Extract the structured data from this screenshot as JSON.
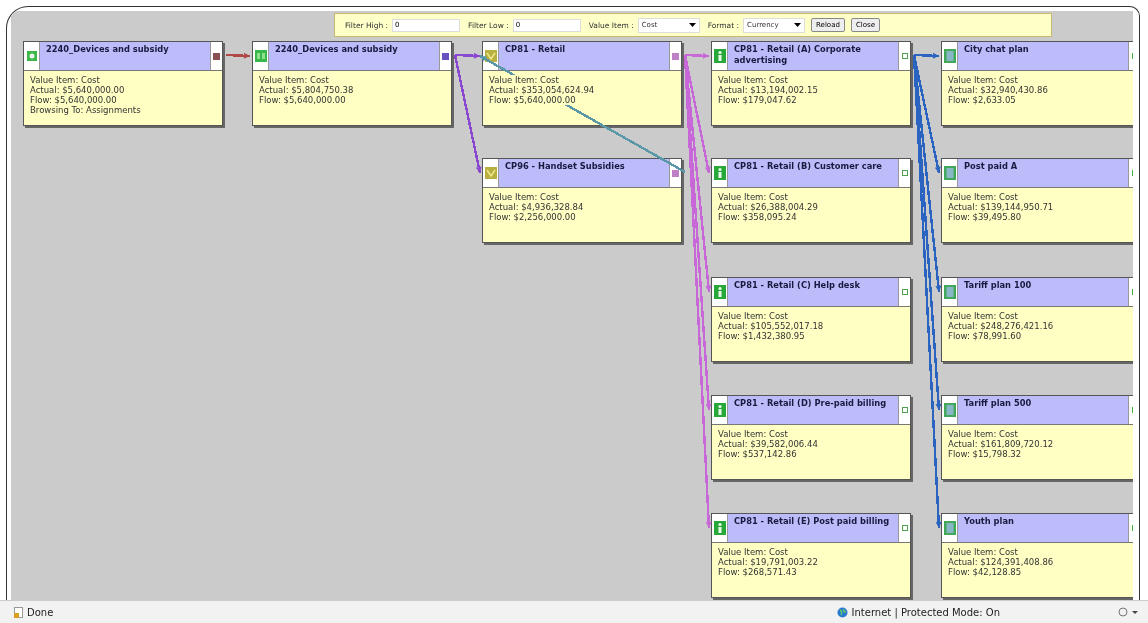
{
  "toolbar": {
    "filter_high": {
      "label": "Filter High :",
      "value": "0"
    },
    "filter_low": {
      "label": "Filter Low :",
      "value": "0"
    },
    "value_item": {
      "label": "Value Item :",
      "value": "Cost"
    },
    "format": {
      "label": "Format :",
      "value": "Currency"
    },
    "buttons": [
      "Reload",
      "Close"
    ]
  },
  "nodes": [
    {
      "kind": "source",
      "title": "2240_Devices and subsidy",
      "lines": [
        "Value Item: Cost",
        "Actual: $5,640,000.00",
        "Flow: $5,640,000.00",
        "Browsing To: Assignments"
      ]
    },
    {
      "kind": "resource",
      "title": "2240_Devices and subsidy",
      "lines": [
        "Value Item: Cost",
        "Actual: $5,804,750.38",
        "Flow: $5,640,000.00"
      ]
    },
    {
      "kind": "center",
      "title": "CP81 - Retail",
      "lines": [
        "Value Item: Cost",
        "Actual: $353,054,624.94",
        "Flow: $5,640,000.00"
      ]
    },
    {
      "kind": "center",
      "title": "CP96 - Handset Subsidies",
      "lines": [
        "Value Item: Cost",
        "Actual: $4,936,328.84",
        "Flow: $2,256,000.00"
      ]
    },
    {
      "kind": "activity",
      "title": "CP81 - Retail (A) Corporate advertising",
      "lines": [
        "Value Item: Cost",
        "Actual: $13,194,002.15",
        "Flow: $179,047.62"
      ]
    },
    {
      "kind": "activity",
      "title": "CP81 - Retail (B) Customer care",
      "lines": [
        "Value Item: Cost",
        "Actual: $26,388,004.29",
        "Flow: $358,095.24"
      ]
    },
    {
      "kind": "activity",
      "title": "CP81 - Retail (C) Help desk",
      "lines": [
        "Value Item: Cost",
        "Actual: $105,552,017.18",
        "Flow: $1,432,380.95"
      ]
    },
    {
      "kind": "activity",
      "title": "CP81 - Retail (D) Pre-paid billing",
      "lines": [
        "Value Item: Cost",
        "Actual: $39,582,006.44",
        "Flow: $537,142.86"
      ]
    },
    {
      "kind": "activity",
      "title": "CP81 - Retail (E) Post paid billing",
      "lines": [
        "Value Item: Cost",
        "Actual: $19,791,003.22",
        "Flow: $268,571.43"
      ]
    },
    {
      "kind": "product",
      "title": "City chat plan",
      "lines": [
        "Value Item: Cost",
        "Actual: $32,940,430.86",
        "Flow: $2,633.05"
      ]
    },
    {
      "kind": "product",
      "title": "Post paid A",
      "lines": [
        "Value Item: Cost",
        "Actual: $139,144,950.71",
        "Flow: $39,495.80"
      ]
    },
    {
      "kind": "product",
      "title": "Tariff plan 100",
      "lines": [
        "Value Item: Cost",
        "Actual: $248,276,421.16",
        "Flow: $78,991.60"
      ]
    },
    {
      "kind": "product",
      "title": "Tariff plan 500",
      "lines": [
        "Value Item: Cost",
        "Actual: $161,809,720.12",
        "Flow: $15,798.32"
      ]
    },
    {
      "kind": "product",
      "title": "Youth plan",
      "lines": [
        "Value Item: Cost",
        "Actual: $124,391,408.86",
        "Flow: $42,128.85"
      ]
    }
  ],
  "connectors": [
    {
      "color": "#b04848"
    },
    {
      "color": "#8a48d0"
    },
    {
      "color": "#8a48d0"
    },
    {
      "color": "#5a98a8"
    },
    {
      "color": "#c868d8"
    },
    {
      "color": "#c868d8"
    },
    {
      "color": "#c868d8"
    },
    {
      "color": "#c868d8"
    },
    {
      "color": "#c868d8"
    },
    {
      "color": "#2a64c0"
    },
    {
      "color": "#2a64c0"
    },
    {
      "color": "#2a64c0"
    },
    {
      "color": "#2a64c0"
    },
    {
      "color": "#2a64c0"
    }
  ],
  "status_bar": {
    "status": "Done",
    "zone": "Internet | Protected Mode: On"
  }
}
